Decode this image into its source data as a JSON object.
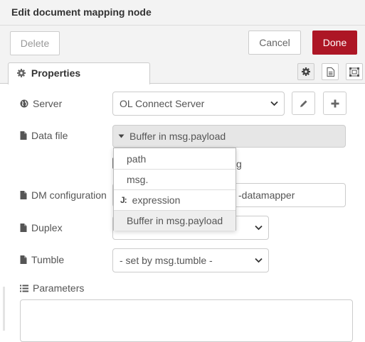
{
  "dialog": {
    "title": "Edit document mapping node",
    "delete_label": "Delete",
    "cancel_label": "Cancel",
    "done_label": "Done"
  },
  "tabs": {
    "properties_label": "Properties"
  },
  "form": {
    "server": {
      "label": "Server",
      "value": "OL Connect Server"
    },
    "data_file": {
      "label": "Data file",
      "value": "Buffer in msg.payload",
      "partial_text": "g"
    },
    "dm_configuration": {
      "label": "DM configuration",
      "partial_value": "-datamapper"
    },
    "duplex": {
      "label": "Duplex"
    },
    "tumble": {
      "label": "Tumble",
      "value": "- set by msg.tumble -"
    },
    "parameters": {
      "label": "Parameters"
    }
  },
  "type_menu": {
    "items": [
      {
        "label": "path"
      },
      {
        "label": "msg."
      },
      {
        "label": "expression",
        "icon": "J:"
      },
      {
        "label": "Buffer in msg.payload"
      }
    ]
  },
  "colors": {
    "done": "#ad1625",
    "header_bg": "#f3f3f3",
    "border": "#cccccc"
  }
}
